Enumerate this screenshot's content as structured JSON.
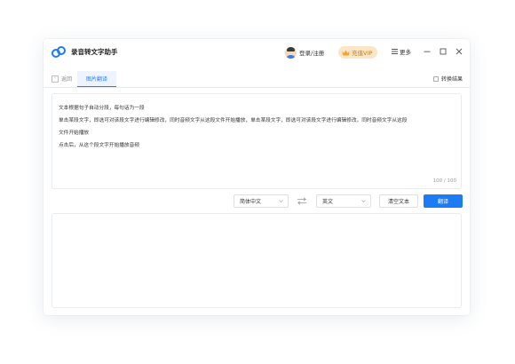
{
  "app": {
    "title": "录音转文字助手"
  },
  "header": {
    "login_label": "登录/注册",
    "vip_label": "充值VIP",
    "more_label": "更多"
  },
  "toolbar": {
    "back_label": "返回",
    "active_tab": "图片翻译",
    "result_label": "转换结果"
  },
  "editor": {
    "lines": [
      "文本根据句子自动分段，每句话为一段",
      "单击某段文字，即选可对该段文字进行编辑修改，同时音频文字从这段文件开始播放，单击某段文字，即选可对该段文字进行编辑修改，同时音频文字从这段",
      "文件开始播放",
      "点击后，从这个段文字开始播放音频"
    ],
    "counter": "100 / 100"
  },
  "controls": {
    "source_language": "简体中文",
    "target_language": "英文",
    "clear_label": "清空文本",
    "translate_label": "翻译"
  },
  "colors": {
    "accent": "#1c7cf5",
    "vip_bg": "#fbe7c8",
    "vip_text": "#c27a19"
  },
  "icons": [
    "logo-icon",
    "avatar",
    "crown-icon",
    "menu-icon",
    "minimize-icon",
    "maximize-icon",
    "close-icon",
    "back-icon",
    "checkbox-icon",
    "swap-icon",
    "chevron-down-icon"
  ]
}
